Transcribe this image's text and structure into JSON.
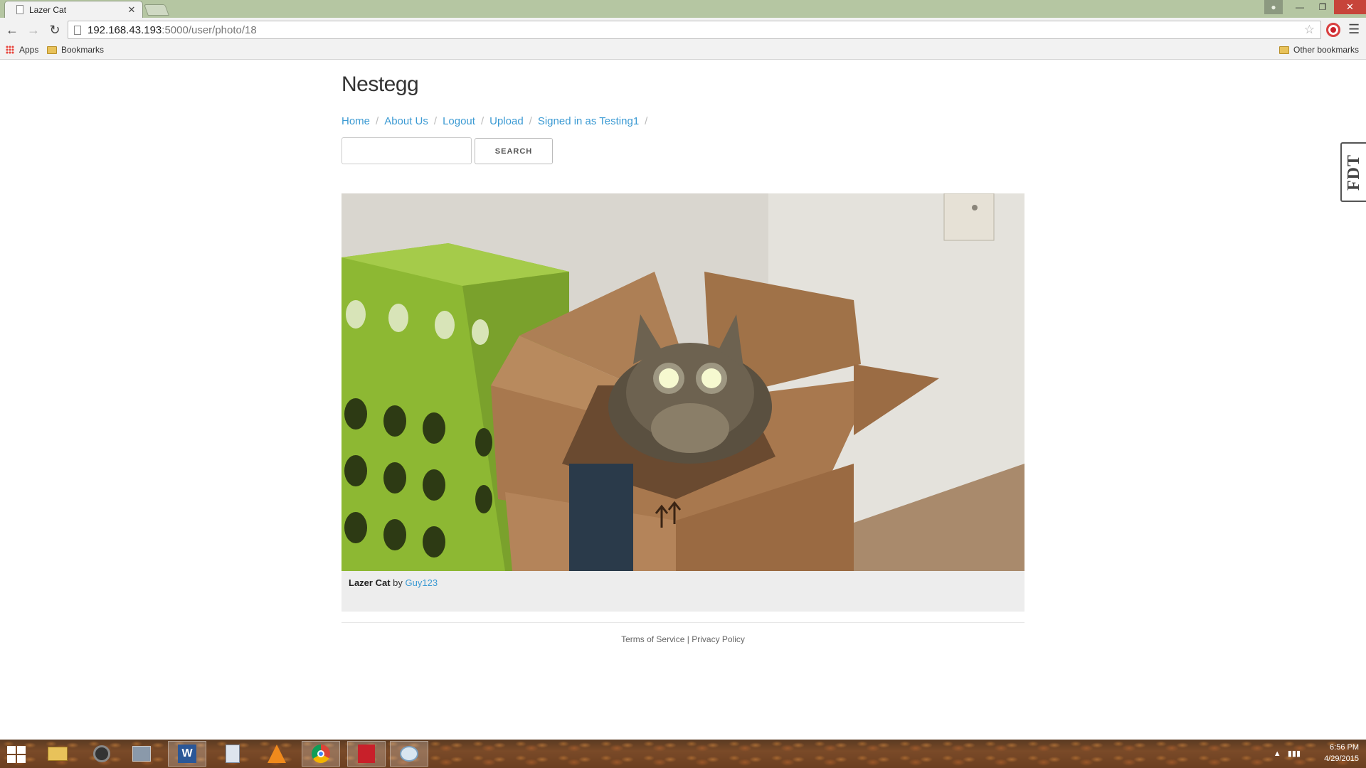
{
  "browser": {
    "tab_title": "Lazer Cat",
    "tab_close": "✕",
    "url_host": "192.168.43.193",
    "url_path": ":5000/user/photo/18",
    "bookmarks": {
      "apps": "Apps",
      "bookmarks": "Bookmarks",
      "other": "Other bookmarks"
    }
  },
  "site": {
    "title": "Nestegg",
    "nav": [
      "Home",
      "About Us",
      "Logout",
      "Upload",
      "Signed in as Testing1"
    ],
    "search_placeholder": "",
    "search_button": "SEARCH"
  },
  "photo": {
    "title": "Lazer Cat",
    "by": "by",
    "author": "Guy123"
  },
  "footer": {
    "terms": "Terms of Service",
    "separator": "|",
    "privacy": "Privacy Policy"
  },
  "side_widget": {
    "label": "FDT"
  },
  "taskbar": {
    "time": "6:56 PM",
    "date": "4/29/2015"
  }
}
